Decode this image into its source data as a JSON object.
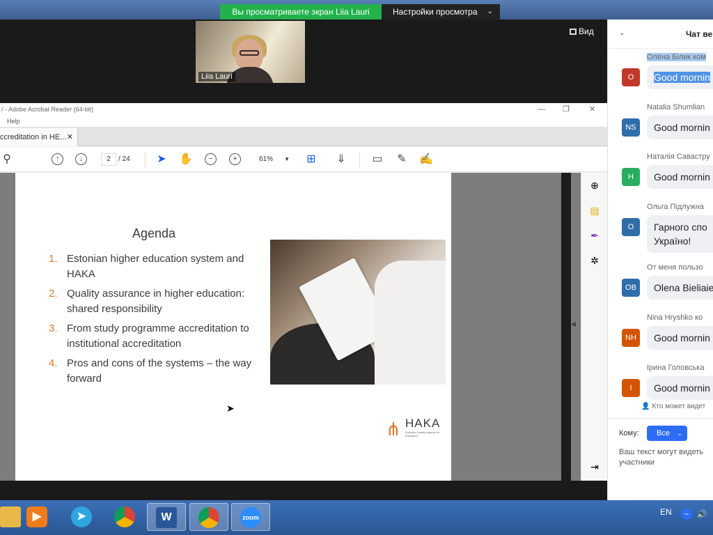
{
  "zoom": {
    "share_banner": "Вы просматриваете экран Liia Lauri",
    "view_settings": "Настройки просмотра",
    "participant_name": "Liia Lauri",
    "view_button": "Вид"
  },
  "acrobat": {
    "title": "/ - Adobe Acrobat Reader (64-bit)",
    "menu_help": "Help",
    "tab_label": "ccreditation in HE...",
    "current_page": "2",
    "total_pages": "/ 24",
    "zoom_level": "61%"
  },
  "slide": {
    "title": "Agenda",
    "items": [
      {
        "num": "1.",
        "text": "Estonian higher education system and HAKA"
      },
      {
        "num": "2.",
        "text": "Quality assurance in  higher education: shared responsibility"
      },
      {
        "num": "3.",
        "text": "From study programme accreditation to institutional accreditation"
      },
      {
        "num": "4.",
        "text": "Pros and cons of the systems – the way forward"
      }
    ],
    "logo_name": "HAKA",
    "logo_sub": "Estonian Quality Agency for Education",
    "accent_color": "#e07a2a"
  },
  "chat": {
    "title": "Чат ве",
    "messages": [
      {
        "sender": "Олена Білик ком",
        "avatar": "О",
        "color": "#c0392b",
        "text": "Good mornin"
      },
      {
        "sender": "Natalia Shumlian",
        "avatar": "NS",
        "color": "#2f6ea8",
        "text": "Good mornin"
      },
      {
        "sender": "Наталія Савастру",
        "avatar": "Н",
        "color": "#27ae60",
        "text": "Good mornin"
      },
      {
        "sender": "Ольга Підлужна",
        "avatar": "О",
        "color": "#2f6ea8",
        "text": "Гарного спо Україно!"
      },
      {
        "sender": "От меня пользо",
        "avatar": "OB",
        "color": "#2f6ea8",
        "text": "Olena Bieliaie"
      },
      {
        "sender": "Nina Hryshko ко",
        "avatar": "NH",
        "color": "#d35400",
        "text": "Good mornin"
      },
      {
        "sender": "Ірина Головська",
        "avatar": "І",
        "color": "#d35400",
        "text": "Good mornin"
      }
    ],
    "who_can_see": "Кто может видет",
    "to_label": "Кому:",
    "to_value": "Все",
    "hint": "Ваш текст могут видеть участники"
  },
  "taskbar": {
    "lang": "EN",
    "zoom_app": "zoom"
  }
}
